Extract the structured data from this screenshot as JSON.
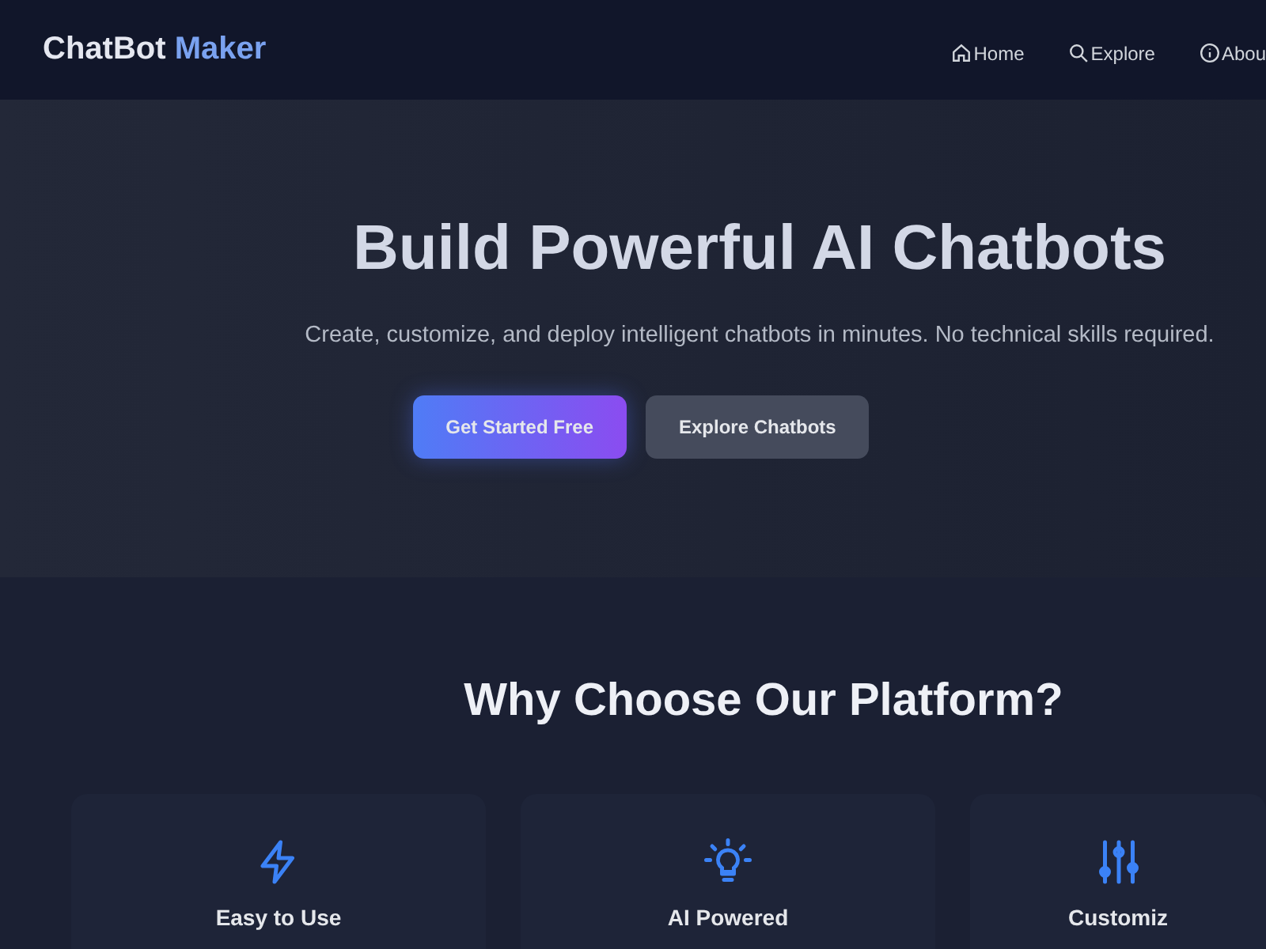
{
  "brand": {
    "name": "ChatBot",
    "accent": "Maker"
  },
  "nav": [
    {
      "kind": "home",
      "label": "Home"
    },
    {
      "kind": "search",
      "label": "Explore"
    },
    {
      "kind": "info",
      "label": "Abou"
    }
  ],
  "hero": {
    "title": "Build Powerful AI Chatbots",
    "subtitle": "Create, customize, and deploy intelligent chatbots in minutes. No technical skills required.",
    "buttons": [
      {
        "kind": "primary",
        "label": "Get Started Free"
      },
      {
        "kind": "secondary",
        "label": "Explore Chatbots"
      }
    ]
  },
  "features": {
    "title": "Why Choose Our Platform?",
    "cards": [
      {
        "kind": "bolt",
        "title": "Easy to Use"
      },
      {
        "kind": "bulb",
        "title": "AI Powered"
      },
      {
        "kind": "sliders",
        "title": "Customiz"
      }
    ]
  }
}
